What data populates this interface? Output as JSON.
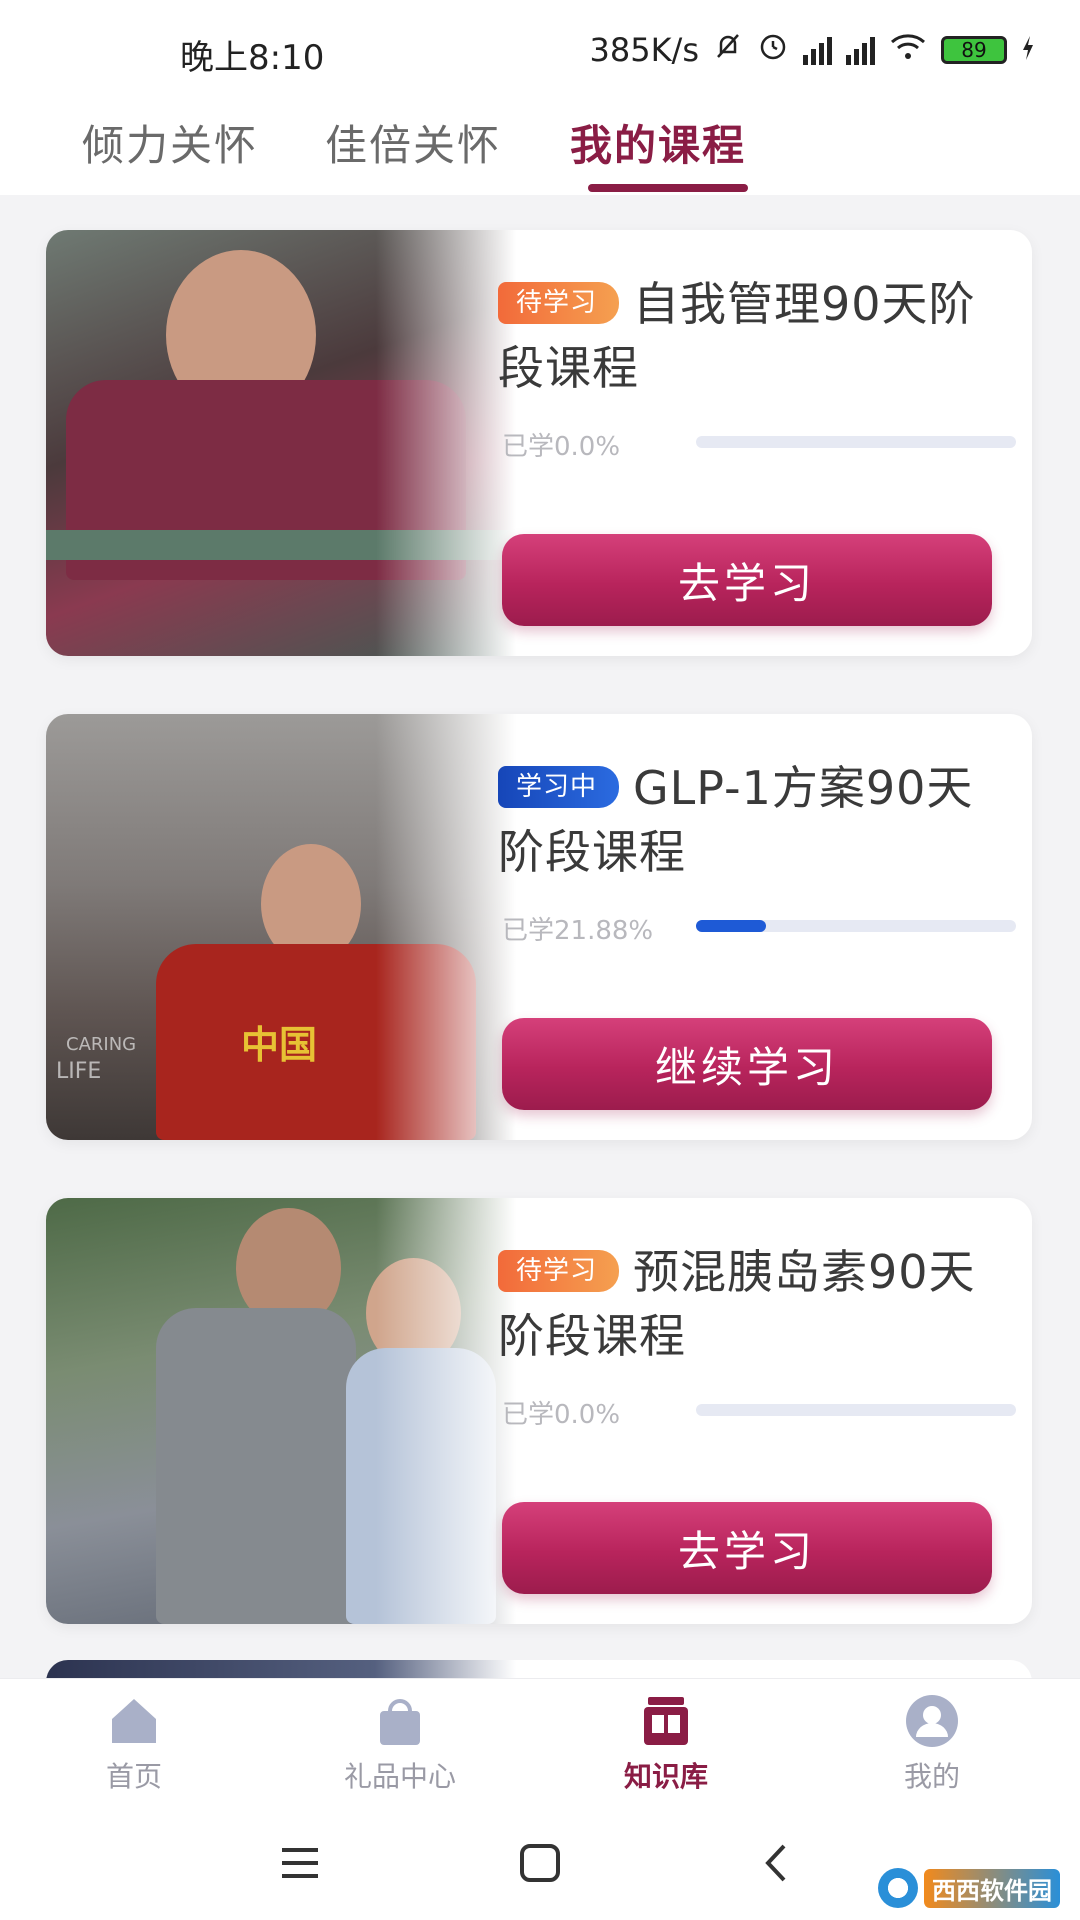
{
  "status_bar": {
    "time": "晚上8:10",
    "network_speed": "385K/s",
    "icons": [
      "mute-bell-icon",
      "alarm-icon",
      "hd-signal-icon",
      "hd-signal-icon",
      "wifi-icon",
      "battery-icon",
      "charging-icon"
    ],
    "battery_level": "89"
  },
  "tabs": [
    {
      "label": "倾力关怀",
      "active": false
    },
    {
      "label": "佳倍关怀",
      "active": false
    },
    {
      "label": "我的课程",
      "active": true
    }
  ],
  "courses": [
    {
      "badge": "待学习",
      "title": "自我管理90天阶段课程",
      "progress_label": "已学0.0%",
      "progress": 0.0,
      "button": "去学习"
    },
    {
      "badge": "学习中",
      "title": "GLP-1方案90天阶段课程",
      "progress_label": "已学21.88%",
      "progress": 21.88,
      "button": "继续学习",
      "photo_text": [
        "CARING",
        "LIFE",
        "中国"
      ]
    },
    {
      "badge": "待学习",
      "title": "预混胰岛素90天阶段课程",
      "progress_label": "已学0.0%",
      "progress": 0.0,
      "button": "去学习"
    }
  ],
  "bottom_nav": [
    {
      "label": "首页",
      "icon": "home-icon",
      "active": false
    },
    {
      "label": "礼品中心",
      "icon": "gift-bag-icon",
      "active": false
    },
    {
      "label": "知识库",
      "icon": "book-icon",
      "active": true
    },
    {
      "label": "我的",
      "icon": "profile-icon",
      "active": false
    }
  ],
  "watermark": "西西软件园",
  "colors": {
    "accent": "#8a1d45",
    "button": "#b8245c",
    "badge_pending": "#f26a3a",
    "badge_active": "#1646b8",
    "progress": "#1e5ad6",
    "inactive_nav": "#9a9aa5"
  }
}
